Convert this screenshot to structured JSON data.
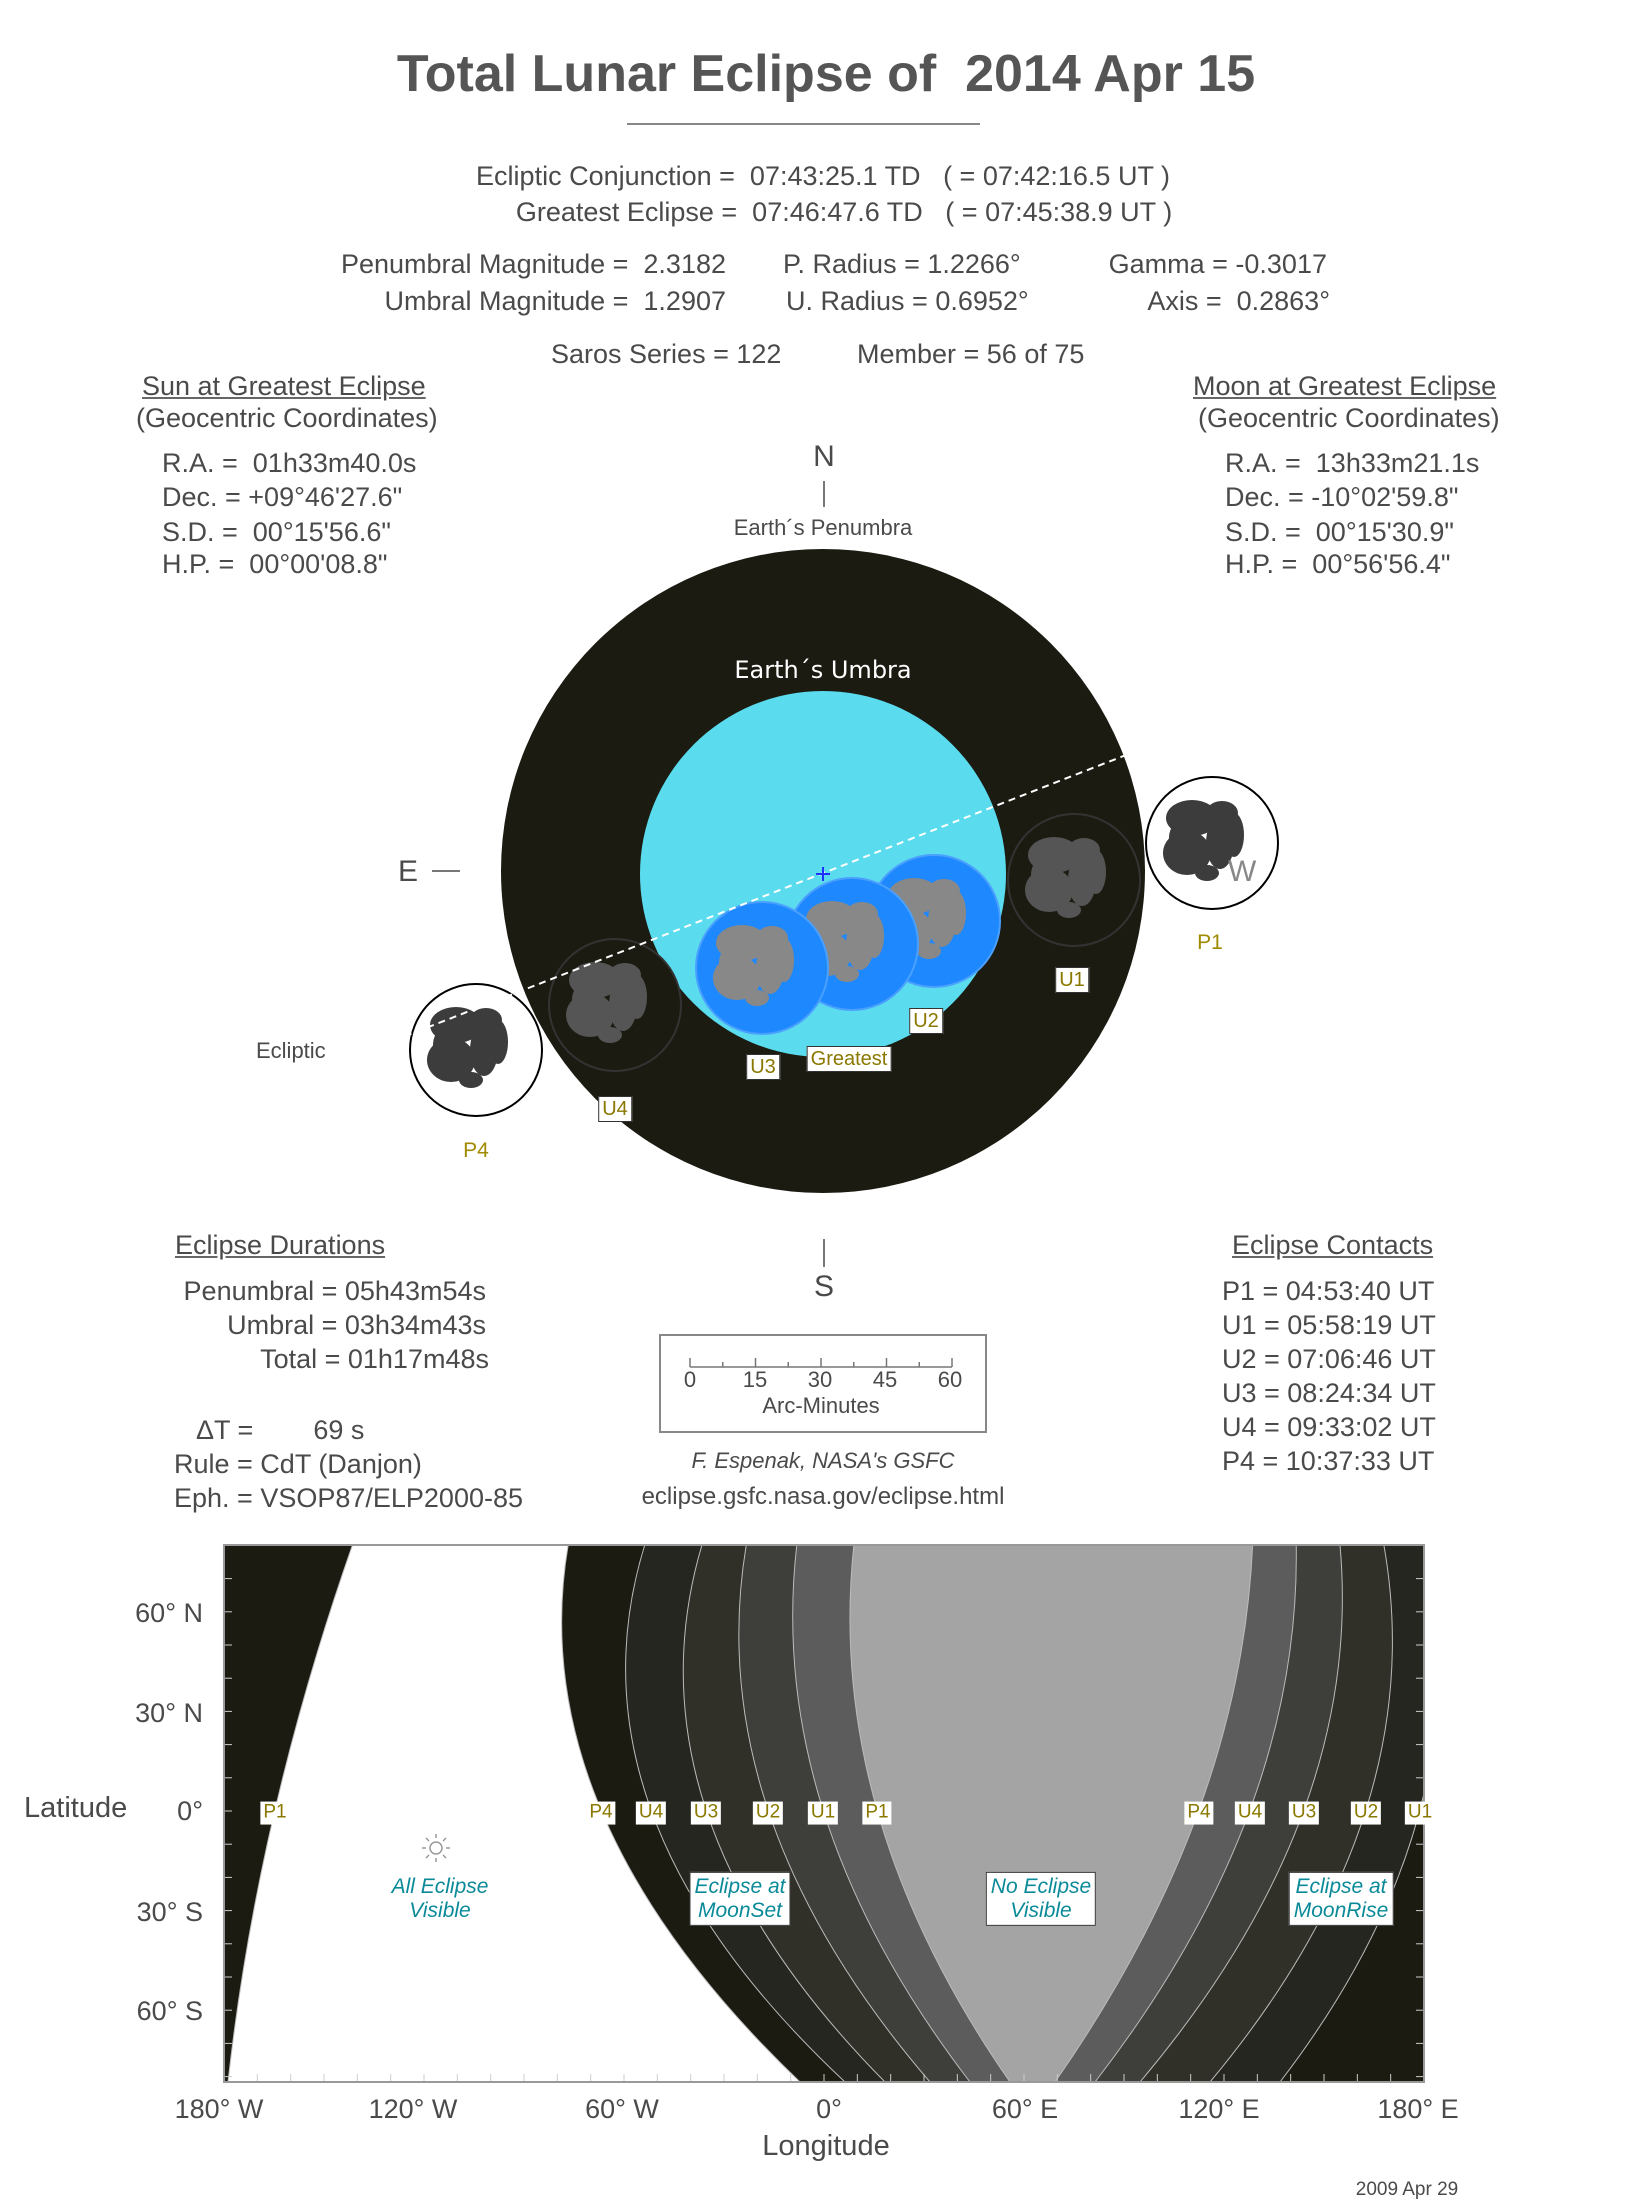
{
  "title": "Total Lunar Eclipse of  2014 Apr 15",
  "header": {
    "conjunction": "Ecliptic Conjunction =  07:43:25.1 TD   ( = 07:42:16.5 UT )",
    "greatest": "Greatest Eclipse =  07:46:47.6 TD   ( = 07:45:38.9 UT )",
    "pen_mag": "Penumbral Magnitude =  2.3182",
    "umb_mag": "Umbral Magnitude =  1.2907",
    "p_radius": "P. Radius = 1.2266°",
    "u_radius": "U. Radius = 0.6952°",
    "gamma": "Gamma = -0.3017",
    "axis": "Axis =  0.2863°",
    "saros": "Saros Series = 122",
    "member": "Member = 56 of 75"
  },
  "sun": {
    "heading": "Sun at Greatest Eclipse",
    "sub": "(Geocentric Coordinates)",
    "rows": [
      "R.A. =  01h33m40.0s",
      "Dec. = +09°46'27.6\"",
      "S.D. =  00°15'56.6\"",
      "H.P. =  00°00'08.8\""
    ]
  },
  "moon": {
    "heading": "Moon at Greatest Eclipse",
    "sub": "(Geocentric Coordinates)",
    "rows": [
      "R.A. =  13h33m21.1s",
      "Dec. = -10°02'59.8\"",
      "S.D. =  00°15'30.9\"",
      "H.P. =  00°56'56.4\""
    ]
  },
  "diagram": {
    "north": "N",
    "south": "S",
    "east": "E",
    "west": "W",
    "penumbra_label": "Earth´s Penumbra",
    "umbra_label": "Earth´s Umbra",
    "ecliptic_label": "Ecliptic",
    "contacts": {
      "P1": "P1",
      "U1": "U1",
      "U2": "U2",
      "G": "Greatest",
      "U3": "U3",
      "U4": "U4",
      "P4": "P4"
    },
    "colors": {
      "penumbra": "#1c1b12",
      "umbra": "#5adbee",
      "moon_umbral": "#1e88ff",
      "label_text": "#b8a000"
    }
  },
  "durations": {
    "heading": "Eclipse Durations",
    "rows": [
      "Penumbral = 05h43m54s",
      "Umbral = 03h34m43s",
      "Total = 01h17m48s"
    ],
    "delta_t": "ΔT =        69 s",
    "rule": "Rule = CdT (Danjon)",
    "eph": "Eph. = VSOP87/ELP2000-85"
  },
  "scale": {
    "ticks": [
      "0",
      "15",
      "30",
      "45",
      "60"
    ],
    "label": "Arc-Minutes"
  },
  "credit": {
    "author": "F. Espenak, NASA's GSFC",
    "url": "eclipse.gsfc.nasa.gov/eclipse.html"
  },
  "contacts": {
    "heading": "Eclipse Contacts",
    "rows": [
      "P1 = 04:53:40 UT",
      "U1 = 05:58:19 UT",
      "U2 = 07:06:46 UT",
      "U3 = 08:24:34 UT",
      "U4 = 09:33:02 UT",
      "P4 = 10:37:33 UT"
    ]
  },
  "map": {
    "lat_label": "Latitude",
    "lon_label": "Longitude",
    "lat_ticks": [
      "60° N",
      "30° N",
      "0°",
      "30° S",
      "60° S"
    ],
    "lon_ticks": [
      "180° W",
      "120° W",
      "60° W",
      "0°",
      "60° E",
      "120° E",
      "180° E"
    ],
    "equator_contacts_west": [
      "P1",
      "P4",
      "U4",
      "U3",
      "U2",
      "U1",
      "P1"
    ],
    "equator_contacts_east": [
      "P4",
      "U4",
      "U3",
      "U2",
      "U1"
    ],
    "regions": {
      "all": "All Eclipse\nVisible",
      "moonset": "Eclipse at\nMoonSet",
      "none": "No Eclipse\nVisible",
      "moonrise": "Eclipse at\nMoonRise"
    }
  },
  "date_stamp": "2009 Apr 29"
}
